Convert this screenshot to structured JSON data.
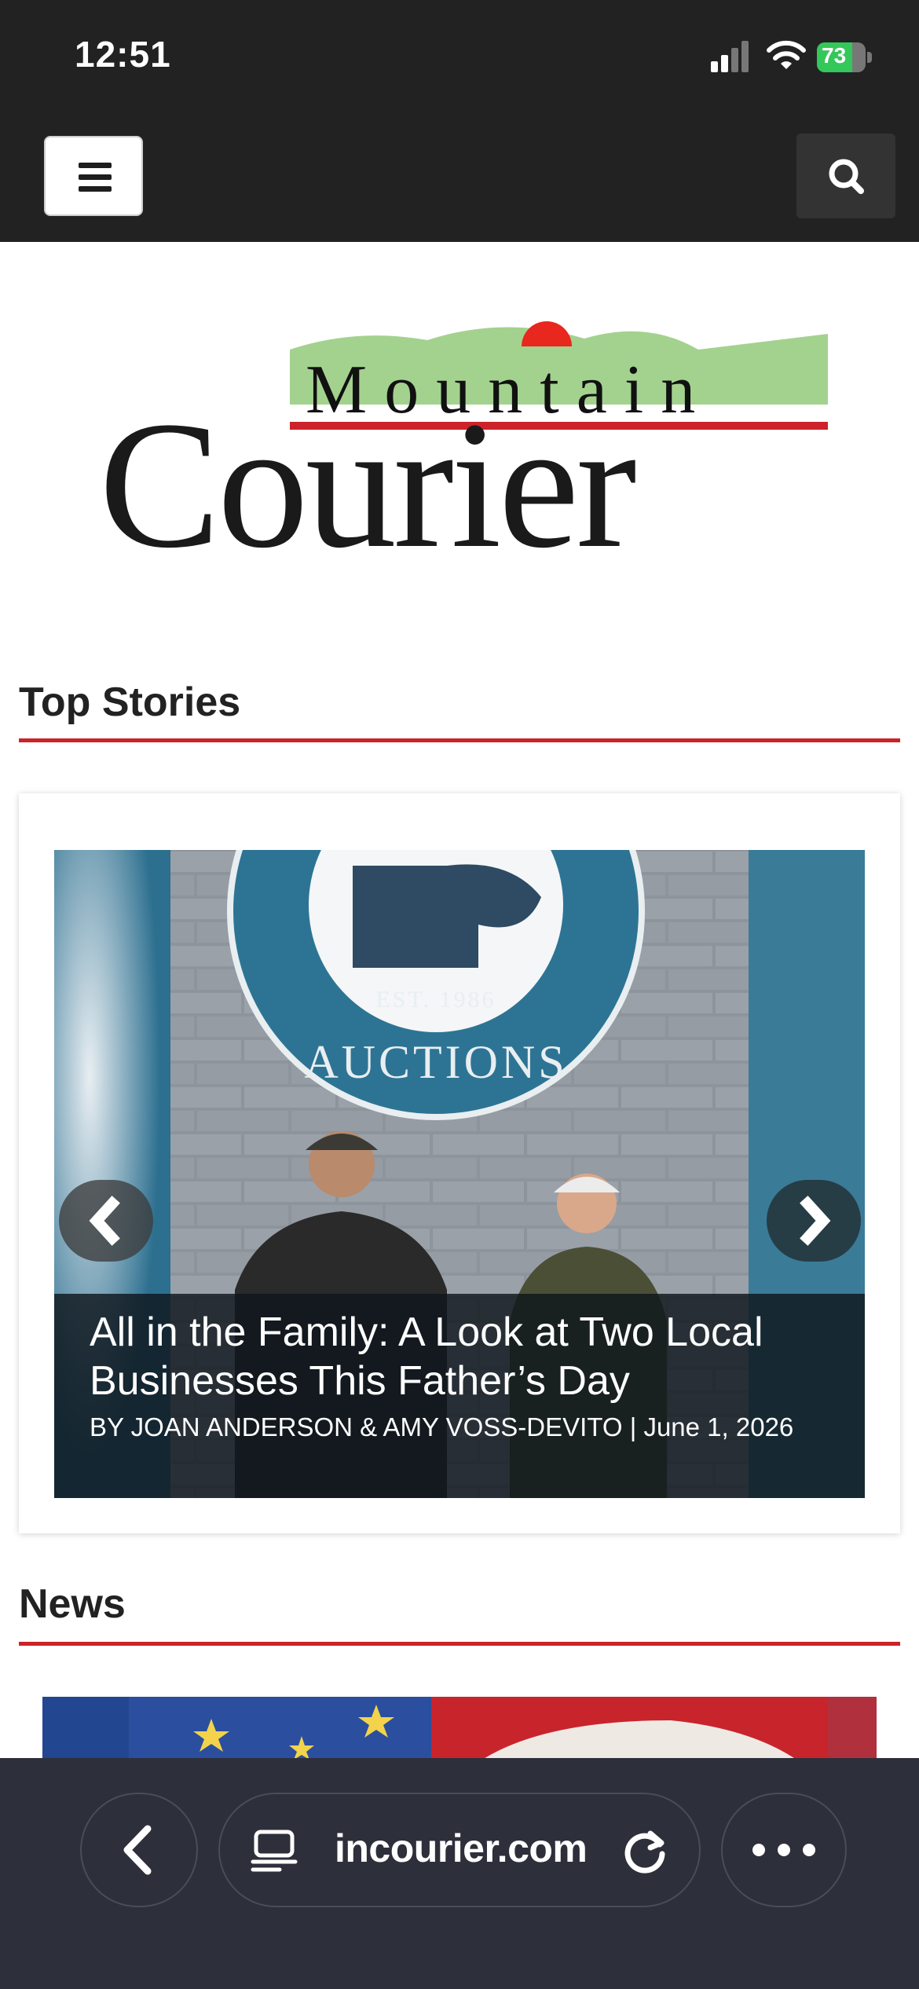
{
  "status_bar": {
    "time": "12:51",
    "battery_percent": "73"
  },
  "header": {
    "menu_label": "",
    "search_label": ""
  },
  "logo": {
    "word_top": "Mountain",
    "word_bottom": "Courier"
  },
  "top_stories": {
    "title": "Top Stories",
    "slide": {
      "headline": "All in the Family: A Look at Two Local Businesses This Father’s Day",
      "byline": "BY JOAN ANDERSON & AMY VOSS-DEVITO | June 1, 2026",
      "sign_text_top": "EST.   1986",
      "sign_text_bottom": "AUCTIONS"
    }
  },
  "news": {
    "title": "News"
  },
  "browser": {
    "url": "incourier.com"
  },
  "colors": {
    "accent_red": "#cc2229",
    "header_bg": "#222222",
    "toolbar_bg": "#2d2f3b",
    "battery_green": "#34c759"
  },
  "icons": [
    "hamburger-icon",
    "search-icon",
    "chevron-left-icon",
    "chevron-right-icon",
    "back-icon",
    "tabs-icon",
    "reload-icon",
    "more-icon",
    "signal-icon",
    "wifi-icon",
    "battery-icon"
  ]
}
